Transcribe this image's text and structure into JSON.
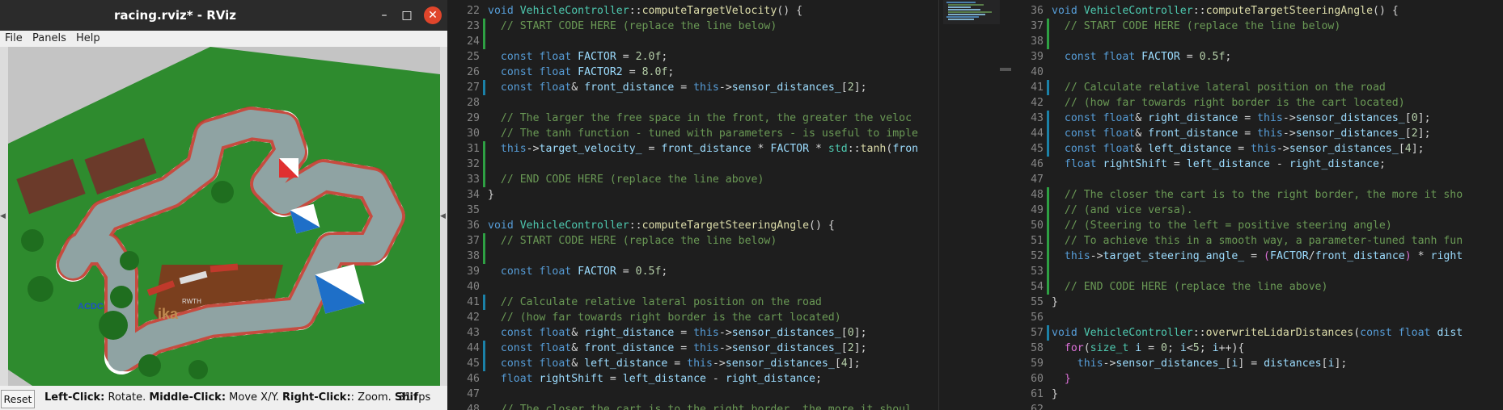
{
  "rviz": {
    "title": "racing.rviz* - RViz",
    "buttons": {
      "minimize": "–",
      "maximize": "□",
      "close": "✕"
    },
    "menu": [
      "File",
      "Panels",
      "Help"
    ],
    "scene_labels": {
      "brand_left": "ACDC",
      "brand_mid": "ika",
      "brand_mid2": "RWTH"
    },
    "status": {
      "reset": "Reset",
      "hint_left_click": "Left-Click:",
      "hint_left_action": " Rotate. ",
      "hint_middle_click": "Middle-Click:",
      "hint_middle_action": " Move X/Y. ",
      "hint_right_click": "Right-Click:",
      "hint_right_action": ": Zoom. ",
      "hint_shift": "Shif",
      "fps": "31 fps"
    }
  },
  "editor_left": {
    "lines": [
      {
        "n": "22",
        "segs": [
          [
            "kw",
            "void "
          ],
          [
            "ty",
            "VehicleController"
          ],
          [
            "op",
            "::"
          ],
          [
            "fn",
            "computeTargetVelocity"
          ],
          [
            "op",
            "() {"
          ]
        ]
      },
      {
        "n": "23",
        "segs": [
          [
            "op",
            "  "
          ],
          [
            "cm",
            "// START CODE HERE (replace the line below)"
          ]
        ]
      },
      {
        "n": "24",
        "segs": []
      },
      {
        "n": "25",
        "segs": [
          [
            "op",
            "  "
          ],
          [
            "kw",
            "const float "
          ],
          [
            "vr",
            "FACTOR"
          ],
          [
            "op",
            " = "
          ],
          [
            "nm",
            "2.0f"
          ],
          [
            "op",
            ";"
          ]
        ]
      },
      {
        "n": "26",
        "segs": [
          [
            "op",
            "  "
          ],
          [
            "kw",
            "const float "
          ],
          [
            "vr",
            "FACTOR2"
          ],
          [
            "op",
            " = "
          ],
          [
            "nm",
            "8.0f"
          ],
          [
            "op",
            ";"
          ]
        ]
      },
      {
        "n": "27",
        "segs": [
          [
            "op",
            "  "
          ],
          [
            "kw",
            "const float"
          ],
          [
            "op",
            "& "
          ],
          [
            "vr",
            "front_distance"
          ],
          [
            "op",
            " = "
          ],
          [
            "kw",
            "this"
          ],
          [
            "op",
            "->"
          ],
          [
            "vr",
            "sensor_distances_"
          ],
          [
            "op",
            "["
          ],
          [
            "nm",
            "2"
          ],
          [
            "op",
            "];"
          ]
        ]
      },
      {
        "n": "28",
        "segs": []
      },
      {
        "n": "29",
        "segs": [
          [
            "op",
            "  "
          ],
          [
            "cm",
            "// The larger the free space in the front, the greater the veloc"
          ]
        ]
      },
      {
        "n": "30",
        "segs": [
          [
            "op",
            "  "
          ],
          [
            "cm",
            "// The tanh function - tuned with parameters - is useful to imple"
          ]
        ]
      },
      {
        "n": "31",
        "segs": [
          [
            "op",
            "  "
          ],
          [
            "kw",
            "this"
          ],
          [
            "op",
            "->"
          ],
          [
            "vr",
            "target_velocity_"
          ],
          [
            "op",
            " = "
          ],
          [
            "vr",
            "front_distance"
          ],
          [
            "op",
            " * "
          ],
          [
            "vr",
            "FACTOR"
          ],
          [
            "op",
            " * "
          ],
          [
            "ty",
            "std"
          ],
          [
            "op",
            "::"
          ],
          [
            "fn",
            "tanh"
          ],
          [
            "op",
            "("
          ],
          [
            "vr",
            "fron"
          ]
        ]
      },
      {
        "n": "32",
        "segs": []
      },
      {
        "n": "33",
        "segs": [
          [
            "op",
            "  "
          ],
          [
            "cm",
            "// END CODE HERE (replace the line above)"
          ]
        ]
      },
      {
        "n": "34",
        "segs": [
          [
            "op",
            "}"
          ]
        ]
      },
      {
        "n": "35",
        "segs": []
      },
      {
        "n": "36",
        "segs": [
          [
            "kw",
            "void "
          ],
          [
            "ty",
            "VehicleController"
          ],
          [
            "op",
            "::"
          ],
          [
            "fn",
            "computeTargetSteeringAngle"
          ],
          [
            "op",
            "() {"
          ]
        ]
      },
      {
        "n": "37",
        "segs": [
          [
            "op",
            "  "
          ],
          [
            "cm",
            "// START CODE HERE (replace the line below)"
          ]
        ]
      },
      {
        "n": "38",
        "segs": []
      },
      {
        "n": "39",
        "segs": [
          [
            "op",
            "  "
          ],
          [
            "kw",
            "const float "
          ],
          [
            "vr",
            "FACTOR"
          ],
          [
            "op",
            " = "
          ],
          [
            "nm",
            "0.5f"
          ],
          [
            "op",
            ";"
          ]
        ]
      },
      {
        "n": "40",
        "segs": []
      },
      {
        "n": "41",
        "segs": [
          [
            "op",
            "  "
          ],
          [
            "cm",
            "// Calculate relative lateral position on the road"
          ]
        ]
      },
      {
        "n": "42",
        "segs": [
          [
            "op",
            "  "
          ],
          [
            "cm",
            "// (how far towards right border is the cart located)"
          ]
        ]
      },
      {
        "n": "43",
        "segs": [
          [
            "op",
            "  "
          ],
          [
            "kw",
            "const float"
          ],
          [
            "op",
            "& "
          ],
          [
            "vr",
            "right_distance"
          ],
          [
            "op",
            " = "
          ],
          [
            "kw",
            "this"
          ],
          [
            "op",
            "->"
          ],
          [
            "vr",
            "sensor_distances_"
          ],
          [
            "op",
            "["
          ],
          [
            "nm",
            "0"
          ],
          [
            "op",
            "];"
          ]
        ]
      },
      {
        "n": "44",
        "segs": [
          [
            "op",
            "  "
          ],
          [
            "kw",
            "const float"
          ],
          [
            "op",
            "& "
          ],
          [
            "vr",
            "front_distance"
          ],
          [
            "op",
            " = "
          ],
          [
            "kw",
            "this"
          ],
          [
            "op",
            "->"
          ],
          [
            "vr",
            "sensor_distances_"
          ],
          [
            "op",
            "["
          ],
          [
            "nm",
            "2"
          ],
          [
            "op",
            "];"
          ]
        ]
      },
      {
        "n": "45",
        "segs": [
          [
            "op",
            "  "
          ],
          [
            "kw",
            "const float"
          ],
          [
            "op",
            "& "
          ],
          [
            "vr",
            "left_distance"
          ],
          [
            "op",
            " = "
          ],
          [
            "kw",
            "this"
          ],
          [
            "op",
            "->"
          ],
          [
            "vr",
            "sensor_distances_"
          ],
          [
            "op",
            "["
          ],
          [
            "nm",
            "4"
          ],
          [
            "op",
            "];"
          ]
        ]
      },
      {
        "n": "46",
        "segs": [
          [
            "op",
            "  "
          ],
          [
            "kw",
            "float "
          ],
          [
            "vr",
            "rightShift"
          ],
          [
            "op",
            " = "
          ],
          [
            "vr",
            "left_distance"
          ],
          [
            "op",
            " - "
          ],
          [
            "vr",
            "right_distance"
          ],
          [
            "op",
            ";"
          ]
        ]
      },
      {
        "n": "47",
        "segs": []
      },
      {
        "n": "48",
        "segs": [
          [
            "op",
            "  "
          ],
          [
            "cm",
            "// The closer the cart is to the right border, the more it shoul"
          ]
        ]
      }
    ]
  },
  "editor_right": {
    "lines": [
      {
        "n": "36",
        "segs": [
          [
            "kw",
            "void "
          ],
          [
            "ty",
            "VehicleController"
          ],
          [
            "op",
            "::"
          ],
          [
            "fn",
            "computeTargetSteeringAngle"
          ],
          [
            "op",
            "() {"
          ]
        ]
      },
      {
        "n": "37",
        "segs": [
          [
            "op",
            "  "
          ],
          [
            "cm",
            "// START CODE HERE (replace the line below)"
          ]
        ]
      },
      {
        "n": "38",
        "segs": []
      },
      {
        "n": "39",
        "segs": [
          [
            "op",
            "  "
          ],
          [
            "kw",
            "const float "
          ],
          [
            "vr",
            "FACTOR"
          ],
          [
            "op",
            " = "
          ],
          [
            "nm",
            "0.5f"
          ],
          [
            "op",
            ";"
          ]
        ]
      },
      {
        "n": "40",
        "segs": []
      },
      {
        "n": "41",
        "segs": [
          [
            "op",
            "  "
          ],
          [
            "cm",
            "// Calculate relative lateral position on the road"
          ]
        ]
      },
      {
        "n": "42",
        "segs": [
          [
            "op",
            "  "
          ],
          [
            "cm",
            "// (how far towards right border is the cart located)"
          ]
        ]
      },
      {
        "n": "43",
        "segs": [
          [
            "op",
            "  "
          ],
          [
            "kw",
            "const float"
          ],
          [
            "op",
            "& "
          ],
          [
            "vr",
            "right_distance"
          ],
          [
            "op",
            " = "
          ],
          [
            "kw",
            "this"
          ],
          [
            "op",
            "->"
          ],
          [
            "vr",
            "sensor_distances_"
          ],
          [
            "op",
            "["
          ],
          [
            "nm",
            "0"
          ],
          [
            "op",
            "];"
          ]
        ]
      },
      {
        "n": "44",
        "segs": [
          [
            "op",
            "  "
          ],
          [
            "kw",
            "const float"
          ],
          [
            "op",
            "& "
          ],
          [
            "vr",
            "front_distance"
          ],
          [
            "op",
            " = "
          ],
          [
            "kw",
            "this"
          ],
          [
            "op",
            "->"
          ],
          [
            "vr",
            "sensor_distances_"
          ],
          [
            "op",
            "["
          ],
          [
            "nm",
            "2"
          ],
          [
            "op",
            "];"
          ]
        ]
      },
      {
        "n": "45",
        "segs": [
          [
            "op",
            "  "
          ],
          [
            "kw",
            "const float"
          ],
          [
            "op",
            "& "
          ],
          [
            "vr",
            "left_distance"
          ],
          [
            "op",
            " = "
          ],
          [
            "kw",
            "this"
          ],
          [
            "op",
            "->"
          ],
          [
            "vr",
            "sensor_distances_"
          ],
          [
            "op",
            "["
          ],
          [
            "nm",
            "4"
          ],
          [
            "op",
            "];"
          ]
        ]
      },
      {
        "n": "46",
        "segs": [
          [
            "op",
            "  "
          ],
          [
            "kw",
            "float "
          ],
          [
            "vr",
            "rightShift"
          ],
          [
            "op",
            " = "
          ],
          [
            "vr",
            "left_distance"
          ],
          [
            "op",
            " - "
          ],
          [
            "vr",
            "right_distance"
          ],
          [
            "op",
            ";"
          ]
        ]
      },
      {
        "n": "47",
        "segs": []
      },
      {
        "n": "48",
        "segs": [
          [
            "op",
            "  "
          ],
          [
            "cm",
            "// The closer the cart is to the right border, the more it sho"
          ]
        ]
      },
      {
        "n": "49",
        "segs": [
          [
            "op",
            "  "
          ],
          [
            "cm",
            "// (and vice versa)."
          ]
        ]
      },
      {
        "n": "50",
        "segs": [
          [
            "op",
            "  "
          ],
          [
            "cm",
            "// (Steering to the left = positive steering angle)"
          ]
        ]
      },
      {
        "n": "51",
        "segs": [
          [
            "op",
            "  "
          ],
          [
            "cm",
            "// To achieve this in a smooth way, a parameter-tuned tanh fun"
          ]
        ]
      },
      {
        "n": "52",
        "segs": [
          [
            "op",
            "  "
          ],
          [
            "kw",
            "this"
          ],
          [
            "op",
            "->"
          ],
          [
            "vr",
            "target_steering_angle_"
          ],
          [
            "op",
            " = "
          ],
          [
            "pu",
            "("
          ],
          [
            "vr",
            "FACTOR"
          ],
          [
            "op",
            "/"
          ],
          [
            "vr",
            "front_distance"
          ],
          [
            "pu",
            ")"
          ],
          [
            "op",
            " * "
          ],
          [
            "vr",
            "right"
          ]
        ]
      },
      {
        "n": "53",
        "segs": []
      },
      {
        "n": "54",
        "segs": [
          [
            "op",
            "  "
          ],
          [
            "cm",
            "// END CODE HERE (replace the line above)"
          ]
        ]
      },
      {
        "n": "55",
        "segs": [
          [
            "op",
            "}"
          ]
        ]
      },
      {
        "n": "56",
        "segs": []
      },
      {
        "n": "57",
        "segs": [
          [
            "kw",
            "void "
          ],
          [
            "ty",
            "VehicleController"
          ],
          [
            "op",
            "::"
          ],
          [
            "fn",
            "overwriteLidarDistances"
          ],
          [
            "op",
            "("
          ],
          [
            "kw",
            "const float "
          ],
          [
            "vr",
            "dist"
          ]
        ]
      },
      {
        "n": "58",
        "segs": [
          [
            "op",
            "  "
          ],
          [
            "pu",
            "for"
          ],
          [
            "op",
            "("
          ],
          [
            "ty",
            "size_t "
          ],
          [
            "vr",
            "i"
          ],
          [
            "op",
            " = "
          ],
          [
            "nm",
            "0"
          ],
          [
            "op",
            "; "
          ],
          [
            "vr",
            "i"
          ],
          [
            "op",
            "<"
          ],
          [
            "nm",
            "5"
          ],
          [
            "op",
            "; "
          ],
          [
            "vr",
            "i"
          ],
          [
            "op",
            "++){"
          ]
        ]
      },
      {
        "n": "59",
        "segs": [
          [
            "op",
            "    "
          ],
          [
            "kw",
            "this"
          ],
          [
            "op",
            "->"
          ],
          [
            "vr",
            "sensor_distances_"
          ],
          [
            "op",
            "["
          ],
          [
            "vr",
            "i"
          ],
          [
            "op",
            "] = "
          ],
          [
            "vr",
            "distances"
          ],
          [
            "op",
            "["
          ],
          [
            "vr",
            "i"
          ],
          [
            "op",
            "];"
          ]
        ]
      },
      {
        "n": "60",
        "segs": [
          [
            "op",
            "  "
          ],
          [
            "pu",
            "}"
          ]
        ]
      },
      {
        "n": "61",
        "segs": [
          [
            "op",
            "}"
          ]
        ]
      },
      {
        "n": "62",
        "segs": []
      }
    ]
  },
  "colors": {
    "kw": "#569cd6",
    "ty": "#4ec9b0",
    "fn": "#dcdcaa",
    "nm": "#b5cea8",
    "cm": "#6a9955",
    "vr": "#9cdcfe",
    "op": "#d4d4d4",
    "pu": "#da70d6",
    "grass": "#2e8b2e",
    "track": "#8fa3a3",
    "git_added": "#2ea043",
    "git_modified": "#1b81a8"
  }
}
